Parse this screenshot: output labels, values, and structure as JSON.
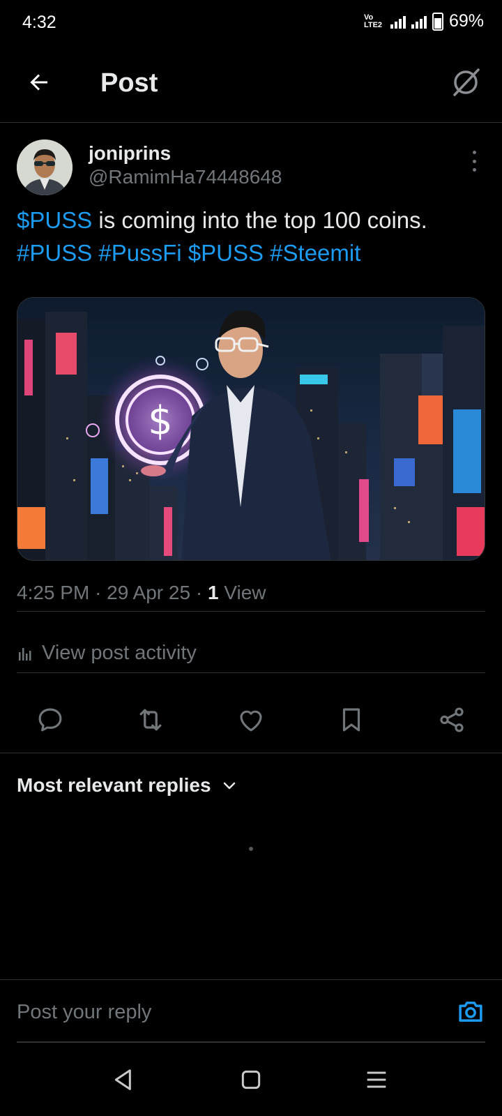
{
  "status_bar": {
    "time": "4:32",
    "network_label": "Vo LTE2",
    "network_type": "4G",
    "battery": "69%"
  },
  "header": {
    "title": "Post",
    "back_icon": "arrow-left-icon",
    "grok_icon": "grok-slash-icon"
  },
  "post": {
    "display_name": "joniprins",
    "handle": "@RamimHa74448648",
    "text_segments": [
      {
        "text": "$PUSS",
        "link": true
      },
      {
        "text": " is coming into the top 100 coins. ",
        "link": false
      },
      {
        "text": "#PUSS",
        "link": true
      },
      {
        "text": " ",
        "link": false
      },
      {
        "text": "#PussFi",
        "link": true
      },
      {
        "text": " ",
        "link": false
      },
      {
        "text": "$PUSS",
        "link": true
      },
      {
        "text": " ",
        "link": false
      },
      {
        "text": "#Steemit",
        "link": true
      }
    ],
    "time": "4:25 PM",
    "date": "29 Apr 25",
    "views_count": "1",
    "views_label": "View",
    "separator": "·",
    "activity_label": "View post activity"
  },
  "actions": {
    "reply_icon": "reply-icon",
    "repost_icon": "repost-icon",
    "like_icon": "heart-icon",
    "bookmark_icon": "bookmark-icon",
    "share_icon": "share-icon"
  },
  "replies": {
    "sort_label": "Most relevant replies"
  },
  "reply_composer": {
    "placeholder": "Post your reply"
  },
  "colors": {
    "background": "#000000",
    "text": "#e7e9ea",
    "secondary": "#71767b",
    "accent": "#1d9bf0",
    "divider": "#2f3336"
  }
}
